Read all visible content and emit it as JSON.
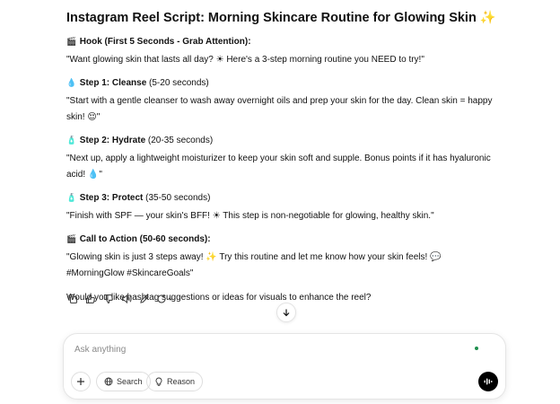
{
  "message": {
    "title": "Instagram Reel Script: Morning Skincare Routine for Glowing Skin ✨",
    "sections": [
      {
        "emoji": "🎬",
        "heading_bold": "Hook (First 5 Seconds - Grab Attention):",
        "heading_rest": "",
        "text": "\"Want glowing skin that lasts all day? ☀ Here's a 3-step morning routine you NEED to try!\""
      },
      {
        "emoji": "💧",
        "heading_bold": "Step 1: Cleanse",
        "heading_rest": " (5-20 seconds)",
        "text": "\"Start with a gentle cleanser to wash away overnight oils and prep your skin for the day. Clean skin = happy skin! 😌\""
      },
      {
        "emoji": "🧴",
        "heading_bold": "Step 2: Hydrate",
        "heading_rest": " (20-35 seconds)",
        "text": "\"Next up, apply a lightweight moisturizer to keep your skin soft and supple. Bonus points if it has hyaluronic acid! 💧\""
      },
      {
        "emoji": "🧴",
        "heading_bold": "Step 3: Protect",
        "heading_rest": " (35-50 seconds)",
        "text": "\"Finish with SPF — your skin's BFF! ☀ This step is non-negotiable for glowing, healthy skin.\""
      },
      {
        "emoji": "🎬",
        "heading_bold": "Call to Action (50-60 seconds):",
        "heading_rest": "",
        "text": "\"Glowing skin is just 3 steps away! ✨ Try this routine and let me know how your skin feels! 💬 #MorningGlow #SkincareGoals\""
      }
    ],
    "followup": "Would you like hashtag suggestions or ideas for visuals to enhance the reel?"
  },
  "actions": {
    "icons": [
      "copy-icon",
      "thumbs-up-icon",
      "thumbs-down-icon",
      "read-aloud-icon",
      "edit-icon",
      "regenerate-icon"
    ]
  },
  "composer": {
    "placeholder": "Ask anything",
    "search_label": "Search",
    "reason_label": "Reason"
  },
  "colors": {
    "text": "#111111",
    "muted": "#8a8a8a",
    "accent_dot": "#1f8f4e",
    "voice_button": "#000000"
  }
}
